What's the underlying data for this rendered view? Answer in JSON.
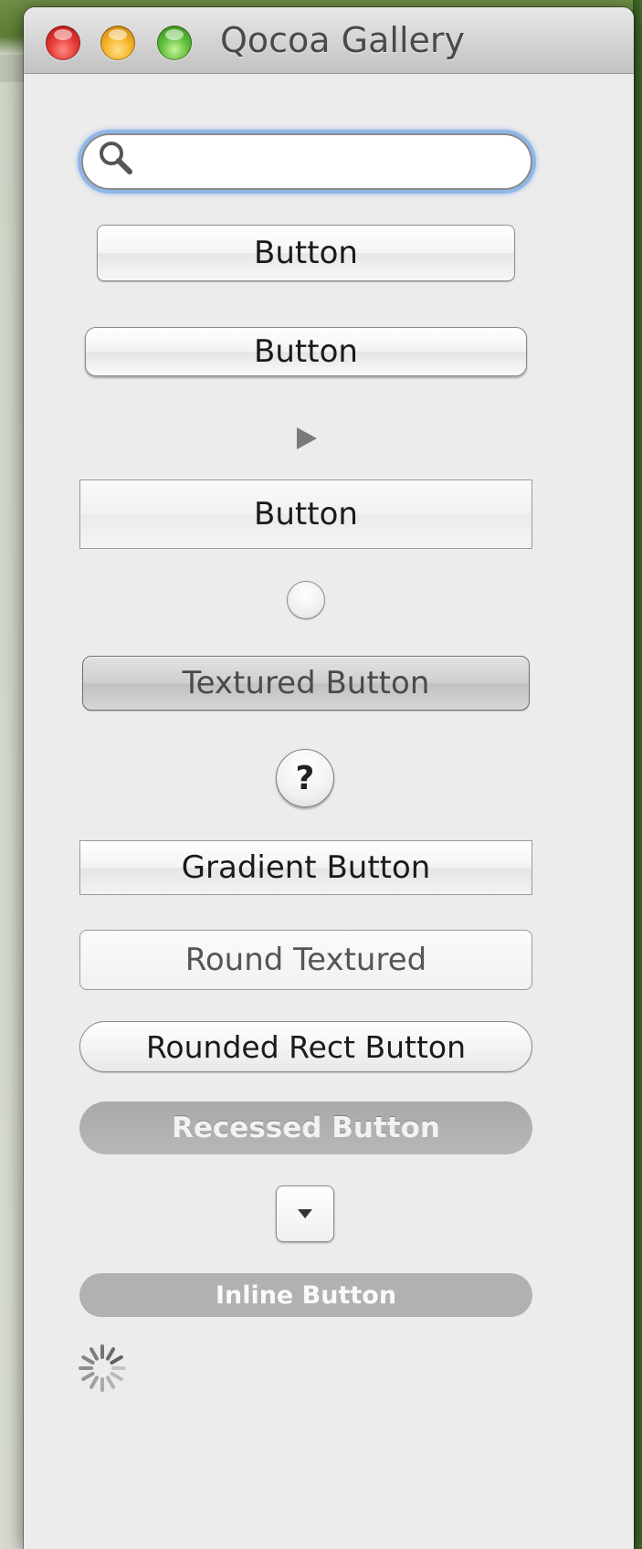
{
  "window": {
    "title": "Qocoa Gallery"
  },
  "search": {
    "value": "",
    "placeholder": ""
  },
  "controls": {
    "push_button": "Button",
    "bevel_button": "Button",
    "square_button": "Button",
    "textured_button": "Textured Button",
    "help_button": "?",
    "gradient_button": "Gradient Button",
    "round_textured_button": "Round Textured",
    "rounded_rect_button": "Rounded Rect Button",
    "recessed_button": "Recessed Button",
    "inline_button": "Inline Button"
  },
  "icons": {
    "search": "search-icon",
    "disclosure": "disclosure-triangle-icon",
    "popdown": "chevron-down-icon",
    "spinner": "progress-spinner-icon"
  },
  "colors": {
    "close": "#e53935",
    "minimize": "#f5b325",
    "zoom": "#5fbf3a",
    "focus_ring": "#8fb7e8"
  }
}
